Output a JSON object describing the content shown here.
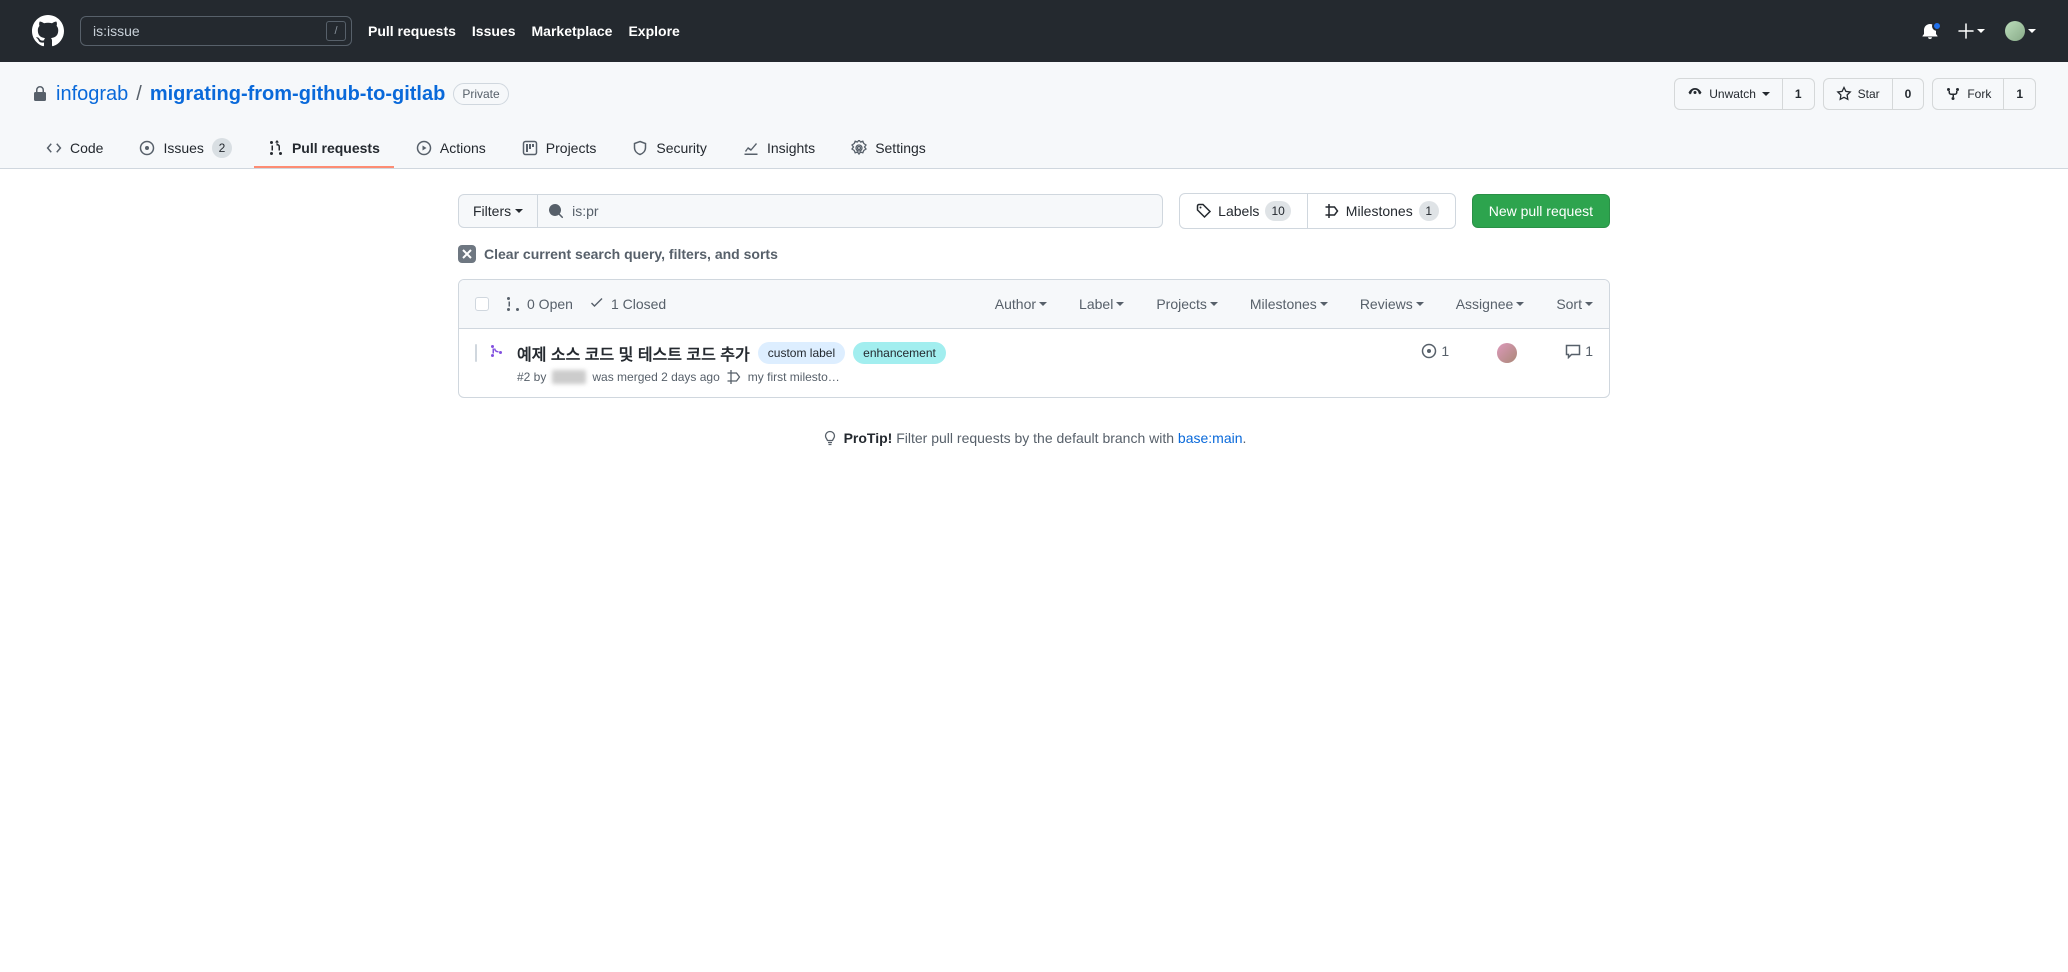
{
  "header": {
    "search_value": "is:issue",
    "nav": [
      "Pull requests",
      "Issues",
      "Marketplace",
      "Explore"
    ]
  },
  "repo": {
    "owner": "infograb",
    "name": "migrating-from-github-to-gitlab",
    "visibility": "Private",
    "watch": {
      "label": "Unwatch",
      "count": "1"
    },
    "star": {
      "label": "Star",
      "count": "0"
    },
    "fork": {
      "label": "Fork",
      "count": "1"
    }
  },
  "tabs": {
    "code": "Code",
    "issues": {
      "label": "Issues",
      "count": "2"
    },
    "pulls": "Pull requests",
    "actions": "Actions",
    "projects": "Projects",
    "security": "Security",
    "insights": "Insights",
    "settings": "Settings"
  },
  "toolbar": {
    "filters": "Filters",
    "search_value": "is:pr",
    "labels": {
      "label": "Labels",
      "count": "10"
    },
    "milestones": {
      "label": "Milestones",
      "count": "1"
    },
    "new_pr": "New pull request"
  },
  "clear": "Clear current search query, filters, and sorts",
  "list": {
    "open": "0 Open",
    "closed": "1 Closed",
    "filters": [
      "Author",
      "Label",
      "Projects",
      "Milestones",
      "Reviews",
      "Assignee",
      "Sort"
    ]
  },
  "items": [
    {
      "title": "예제 소스 코드 및 테스트 코드 추가",
      "labels": [
        {
          "text": "custom label",
          "bg": "#ddeeff",
          "fg": "#24292f"
        },
        {
          "text": "enhancement",
          "bg": "#a2eeef",
          "fg": "#24292f"
        }
      ],
      "sub_prefix": "#2 by ",
      "sub_user": "████",
      "sub_suffix": " was merged 2 days ago",
      "milestone": "my first milesto…",
      "issues": "1",
      "comments": "1"
    }
  ],
  "protip": {
    "bold": "ProTip!",
    "text": " Filter pull requests by the default branch with ",
    "link": "base:main",
    "period": "."
  }
}
